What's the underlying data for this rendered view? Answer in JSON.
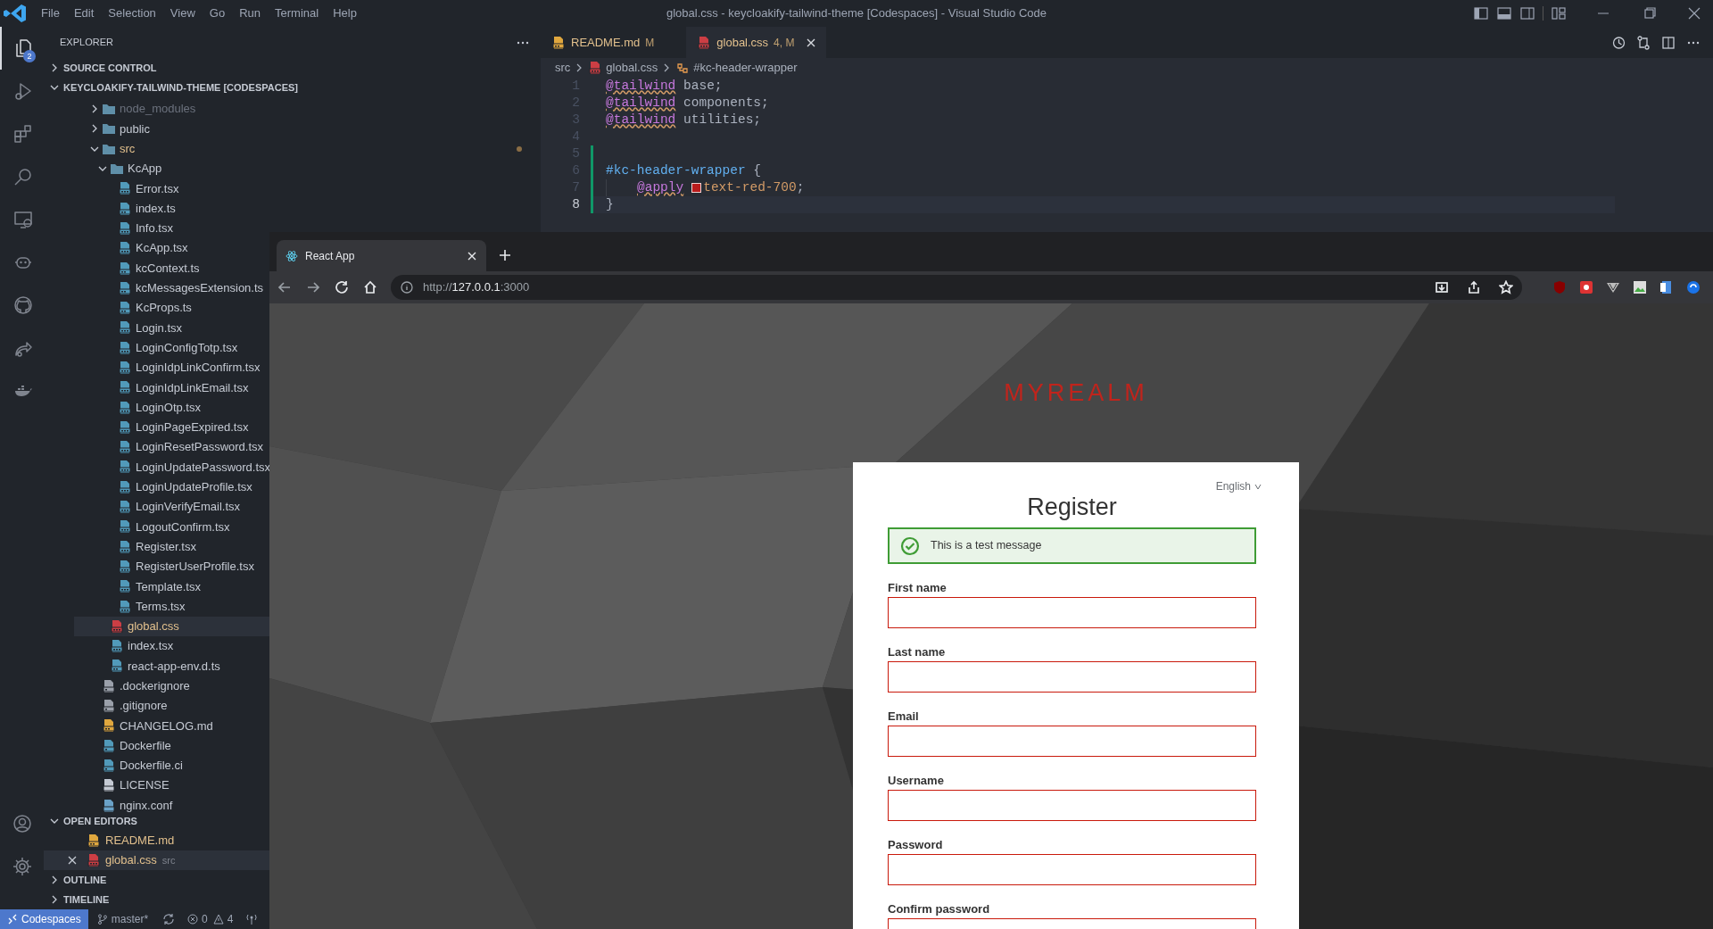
{
  "title_bar": {
    "menu": [
      "File",
      "Edit",
      "Selection",
      "View",
      "Go",
      "Run",
      "Terminal",
      "Help"
    ],
    "title": "global.css - keycloakify-tailwind-theme [Codespaces] - Visual Studio Code"
  },
  "activity_bar": {
    "items": [
      {
        "kind": "explorer",
        "selected": true,
        "badge": "2"
      },
      {
        "kind": "run",
        "selected": false
      },
      {
        "kind": "extensions",
        "selected": false
      },
      {
        "kind": "search",
        "selected": false
      },
      {
        "kind": "remote",
        "selected": false
      },
      {
        "kind": "bot",
        "selected": false
      },
      {
        "kind": "github",
        "selected": false
      },
      {
        "kind": "share",
        "selected": false
      },
      {
        "kind": "docker",
        "selected": false
      }
    ],
    "bottom": [
      {
        "kind": "account"
      },
      {
        "kind": "settings"
      }
    ]
  },
  "sidebar": {
    "title": "EXPLORER",
    "sections": [
      {
        "label": "SOURCE CONTROL",
        "expanded": false
      },
      {
        "label": "KEYCLOAKIFY-TAILWIND-THEME [CODESPACES]",
        "expanded": true
      }
    ],
    "tree": [
      {
        "label": "node_modules",
        "kind": "folder",
        "modified": false,
        "ignored": true,
        "selected": false,
        "expanded": false
      },
      {
        "label": "public",
        "kind": "folder",
        "modified": false,
        "ignored": false,
        "selected": false,
        "expanded": false
      },
      {
        "label": "src",
        "kind": "folder",
        "modified": true,
        "ignored": false,
        "selected": false,
        "expanded": true,
        "children": [
          {
            "label": "KcApp",
            "kind": "folder",
            "modified": false,
            "ignored": false,
            "selected": false,
            "expanded": true,
            "children": [
              {
                "label": "Error.tsx",
                "kind": "tsx",
                "modified": false,
                "ignored": false,
                "selected": false
              },
              {
                "label": "index.ts",
                "kind": "ts",
                "modified": false,
                "ignored": false,
                "selected": false
              },
              {
                "label": "Info.tsx",
                "kind": "tsx",
                "modified": false,
                "ignored": false,
                "selected": false
              },
              {
                "label": "KcApp.tsx",
                "kind": "tsx",
                "modified": false,
                "ignored": false,
                "selected": false
              },
              {
                "label": "kcContext.ts",
                "kind": "ts",
                "modified": false,
                "ignored": false,
                "selected": false
              },
              {
                "label": "kcMessagesExtension.ts",
                "kind": "ts",
                "modified": false,
                "ignored": false,
                "selected": false
              },
              {
                "label": "KcProps.ts",
                "kind": "ts",
                "modified": false,
                "ignored": false,
                "selected": false
              },
              {
                "label": "Login.tsx",
                "kind": "tsx",
                "modified": false,
                "ignored": false,
                "selected": false
              },
              {
                "label": "LoginConfigTotp.tsx",
                "kind": "tsx",
                "modified": false,
                "ignored": false,
                "selected": false
              },
              {
                "label": "LoginIdpLinkConfirm.tsx",
                "kind": "tsx",
                "modified": false,
                "ignored": false,
                "selected": false
              },
              {
                "label": "LoginIdpLinkEmail.tsx",
                "kind": "tsx",
                "modified": false,
                "ignored": false,
                "selected": false
              },
              {
                "label": "LoginOtp.tsx",
                "kind": "tsx",
                "modified": false,
                "ignored": false,
                "selected": false
              },
              {
                "label": "LoginPageExpired.tsx",
                "kind": "tsx",
                "modified": false,
                "ignored": false,
                "selected": false
              },
              {
                "label": "LoginResetPassword.tsx",
                "kind": "tsx",
                "modified": false,
                "ignored": false,
                "selected": false
              },
              {
                "label": "LoginUpdatePassword.tsx",
                "kind": "tsx",
                "modified": false,
                "ignored": false,
                "selected": false
              },
              {
                "label": "LoginUpdateProfile.tsx",
                "kind": "tsx",
                "modified": false,
                "ignored": false,
                "selected": false
              },
              {
                "label": "LoginVerifyEmail.tsx",
                "kind": "tsx",
                "modified": false,
                "ignored": false,
                "selected": false
              },
              {
                "label": "LogoutConfirm.tsx",
                "kind": "tsx",
                "modified": false,
                "ignored": false,
                "selected": false
              },
              {
                "label": "Register.tsx",
                "kind": "tsx",
                "modified": false,
                "ignored": false,
                "selected": false
              },
              {
                "label": "RegisterUserProfile.tsx",
                "kind": "tsx",
                "modified": false,
                "ignored": false,
                "selected": false
              },
              {
                "label": "Template.tsx",
                "kind": "tsx",
                "modified": false,
                "ignored": false,
                "selected": false
              },
              {
                "label": "Terms.tsx",
                "kind": "tsx",
                "modified": false,
                "ignored": false,
                "selected": false
              }
            ]
          },
          {
            "label": "global.css",
            "kind": "css",
            "modified": true,
            "ignored": false,
            "selected": true
          },
          {
            "label": "index.tsx",
            "kind": "tsx",
            "modified": false,
            "ignored": false,
            "selected": false
          },
          {
            "label": "react-app-env.d.ts",
            "kind": "ts",
            "modified": false,
            "ignored": false,
            "selected": false
          }
        ]
      },
      {
        "label": ".dockerignore",
        "kind": "ignore",
        "modified": false,
        "ignored": false,
        "selected": false
      },
      {
        "label": ".gitignore",
        "kind": "ignore",
        "modified": false,
        "ignored": false,
        "selected": false
      },
      {
        "label": "CHANGELOG.md",
        "kind": "md",
        "modified": false,
        "ignored": false,
        "selected": false
      },
      {
        "label": "Dockerfile",
        "kind": "docker",
        "modified": false,
        "ignored": false,
        "selected": false
      },
      {
        "label": "Dockerfile.ci",
        "kind": "docker",
        "modified": false,
        "ignored": false,
        "selected": false
      },
      {
        "label": "LICENSE",
        "kind": "license",
        "modified": false,
        "ignored": false,
        "selected": false
      },
      {
        "label": "nginx.conf",
        "kind": "config",
        "modified": false,
        "ignored": false,
        "selected": false
      }
    ],
    "open_editors": {
      "label": "OPEN EDITORS",
      "expanded": true,
      "items": [
        {
          "label": "README.md",
          "kind": "md",
          "modified": true,
          "selected": false
        },
        {
          "label": "global.css",
          "kind": "css",
          "modified": true,
          "selected": true,
          "description": "src"
        }
      ]
    },
    "footer_sections": [
      {
        "label": "OUTLINE",
        "expanded": false
      },
      {
        "label": "TIMELINE",
        "expanded": false
      }
    ]
  },
  "editor": {
    "tabs": [
      {
        "label": "README.md",
        "kind": "md",
        "badge": "M",
        "selected": false
      },
      {
        "label": "global.css",
        "kind": "css",
        "badge": "4, M",
        "selected": true
      }
    ],
    "breadcrumb": [
      "src",
      "global.css",
      "#kc-header-wrapper"
    ],
    "lines": [
      {
        "number": "1",
        "changed": false,
        "current": false,
        "indented": false,
        "tokens": [
          {
            "kind": "directive",
            "text": "@tailwind"
          },
          {
            "kind": "plain",
            "text": " base;"
          }
        ]
      },
      {
        "number": "2",
        "changed": false,
        "current": false,
        "indented": false,
        "tokens": [
          {
            "kind": "directive",
            "text": "@tailwind"
          },
          {
            "kind": "plain",
            "text": " components;"
          }
        ]
      },
      {
        "number": "3",
        "changed": false,
        "current": false,
        "indented": false,
        "tokens": [
          {
            "kind": "directive",
            "text": "@tailwind"
          },
          {
            "kind": "plain",
            "text": " utilities;"
          }
        ]
      },
      {
        "number": "4",
        "changed": false,
        "current": false,
        "indented": false
      },
      {
        "number": "5",
        "changed": true,
        "current": false,
        "indented": false
      },
      {
        "number": "6",
        "changed": true,
        "current": false,
        "indented": false,
        "tokens": [
          {
            "kind": "selector",
            "text": "#kc-header-wrapper"
          },
          {
            "kind": "plain",
            "text": " {"
          }
        ]
      },
      {
        "number": "7",
        "changed": true,
        "current": false,
        "indented": true,
        "tokens": [
          {
            "kind": "directive",
            "text": "@apply"
          },
          {
            "kind": "swatch",
            "color": "#b91c1c"
          },
          {
            "kind": "value",
            "text": "text-red-700"
          },
          {
            "kind": "plain",
            "text": ";"
          }
        ]
      },
      {
        "number": "8",
        "changed": true,
        "current": true,
        "indented": false,
        "tokens": [
          {
            "kind": "plain",
            "text": "}"
          }
        ]
      }
    ]
  },
  "browser": {
    "tab": {
      "title": "React App"
    },
    "address": {
      "scheme": "http://",
      "host": "127.0.0.1",
      "port": ":3000"
    },
    "page": {
      "realm": "MYREALM",
      "card": {
        "language": "English",
        "title": "Register",
        "alert": {
          "kind": "success",
          "text": "This is a test message"
        },
        "fields": [
          {
            "label": "First name",
            "invalid": true
          },
          {
            "label": "Last name",
            "invalid": true
          },
          {
            "label": "Email",
            "invalid": true
          },
          {
            "label": "Username",
            "invalid": true
          },
          {
            "label": "Password",
            "invalid": true
          },
          {
            "label": "Confirm password",
            "invalid": true
          }
        ]
      }
    }
  },
  "status_bar": {
    "remote": "Codespaces",
    "branch": "master*",
    "errors": "0",
    "warnings": "4"
  }
}
